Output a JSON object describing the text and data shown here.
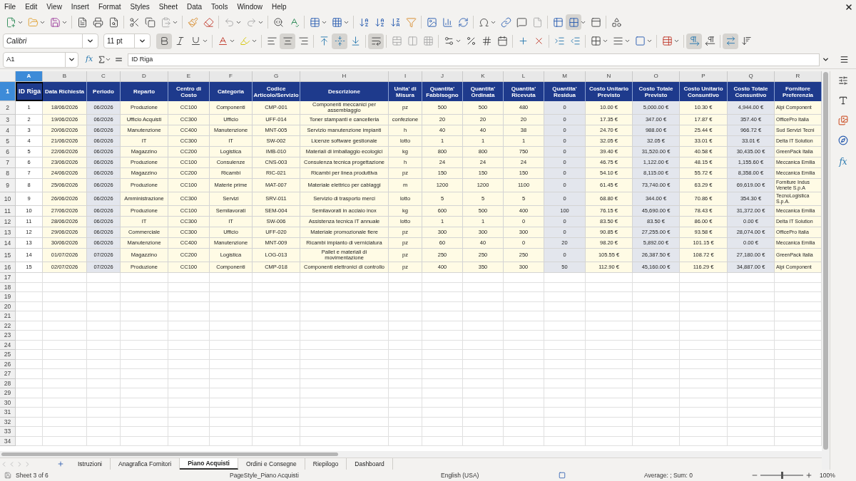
{
  "menu": [
    "File",
    "Edit",
    "View",
    "Insert",
    "Format",
    "Styles",
    "Sheet",
    "Data",
    "Tools",
    "Window",
    "Help"
  ],
  "standard_toolbar": {
    "freeze_rows_columns_on": true
  },
  "font_name": "Calibri",
  "font_size": "11 pt",
  "format_toggles": {
    "bold": true,
    "italic": false,
    "underline": false,
    "align_left": false,
    "align_center": true,
    "align_right": false,
    "valign_top": false,
    "valign_center": true,
    "valign_bottom": false,
    "wrap_text": true,
    "left_to_right": true,
    "right_to_left": false,
    "horizontal_text": true,
    "vertical_text": false
  },
  "name_box": "A1",
  "function_wizard_label": "fx",
  "formula": "ID Riga",
  "columns": [
    {
      "label": "A",
      "selected": true
    },
    {
      "label": "B",
      "selected": false
    },
    {
      "label": "C",
      "selected": false
    },
    {
      "label": "D",
      "selected": false
    },
    {
      "label": "E",
      "selected": false
    },
    {
      "label": "F",
      "selected": false
    },
    {
      "label": "G",
      "selected": false
    },
    {
      "label": "H",
      "selected": false
    },
    {
      "label": "I",
      "selected": false
    },
    {
      "label": "J",
      "selected": false
    },
    {
      "label": "K",
      "selected": false
    },
    {
      "label": "L",
      "selected": false
    },
    {
      "label": "M",
      "selected": false
    },
    {
      "label": "N",
      "selected": false
    },
    {
      "label": "O",
      "selected": false
    },
    {
      "label": "P",
      "selected": false
    },
    {
      "label": "Q",
      "selected": false
    },
    {
      "label": "R",
      "selected": false
    }
  ],
  "header_row": {
    "number": "1",
    "selected": true,
    "cells": [
      "ID Riga",
      "Data Richiesta",
      "Periodo",
      "Reparto",
      "Centro di Costo",
      "Categoria",
      "Codice Articolo/Servizio",
      "Descrizione",
      "Unita' di Misura",
      "Quantita' Fabbisogno",
      "Quantita' Ordinata",
      "Quantita' Ricevuta",
      "Quantita' Residua",
      "Costo Unitario Previsto",
      "Costo Totale Previsto",
      "Costo Unitario Consuntivo",
      "Costo Totale Consuntivo",
      "Fornitore Preferenzia"
    ]
  },
  "rows": [
    {
      "number": "2",
      "cells": [
        "1",
        "18/06/2026",
        "06/2026",
        "Produzione",
        "CC100",
        "Componenti",
        "CMP-001",
        "Componenti meccanici per assemblaggio",
        "pz",
        "500",
        "500",
        "480",
        "0",
        "10.00 €",
        "5,000.00 €",
        "10.30 €",
        "4,944.00 €",
        "Alpi Component"
      ]
    },
    {
      "number": "3",
      "cells": [
        "2",
        "19/06/2026",
        "06/2026",
        "Ufficio Acquisti",
        "CC300",
        "Ufficio",
        "UFF-014",
        "Toner stampanti e cancelleria",
        "confezione",
        "20",
        "20",
        "20",
        "0",
        "17.35 €",
        "347.00 €",
        "17.87 €",
        "357.40 €",
        "OfficePro Italia"
      ]
    },
    {
      "number": "4",
      "cells": [
        "3",
        "20/06/2026",
        "06/2026",
        "Manutenzione",
        "CC400",
        "Manutenzione",
        "MNT-005",
        "Servizio manutenzione impianti",
        "h",
        "40",
        "40",
        "38",
        "0",
        "24.70 €",
        "988.00 €",
        "25.44 €",
        "966.72 €",
        "Sud Servizi Tecni"
      ]
    },
    {
      "number": "5",
      "cells": [
        "4",
        "21/06/2026",
        "06/2026",
        "IT",
        "CC300",
        "IT",
        "SW-002",
        "Licenze software gestionale",
        "lotto",
        "1",
        "1",
        "1",
        "0",
        "32.05 €",
        "32.05 €",
        "33.01 €",
        "33.01 €",
        "Delta IT Solution"
      ]
    },
    {
      "number": "6",
      "cells": [
        "5",
        "22/06/2026",
        "06/2026",
        "Magazzino",
        "CC200",
        "Logistica",
        "IMB-010",
        "Materiali di imballaggio ecologici",
        "kg",
        "800",
        "800",
        "750",
        "0",
        "39.40 €",
        "31,520.00 €",
        "40.58 €",
        "30,435.00 €",
        "GreenPack Italia"
      ]
    },
    {
      "number": "7",
      "cells": [
        "6",
        "23/06/2026",
        "06/2026",
        "Produzione",
        "CC100",
        "Consulenze",
        "CNS-003",
        "Consulenza tecnica progettazione",
        "h",
        "24",
        "24",
        "24",
        "0",
        "46.75 €",
        "1,122.00 €",
        "48.15 €",
        "1,155.60 €",
        "Meccanica Emilia"
      ]
    },
    {
      "number": "8",
      "cells": [
        "7",
        "24/06/2026",
        "06/2026",
        "Magazzino",
        "CC200",
        "Ricambi",
        "RIC-021",
        "Ricambi per linea produttiva",
        "pz",
        "150",
        "150",
        "150",
        "0",
        "54.10 €",
        "8,115.00 €",
        "55.72 €",
        "8,358.00 €",
        "Meccanica Emilia"
      ]
    },
    {
      "number": "9",
      "cells": [
        "8",
        "25/06/2026",
        "06/2026",
        "Produzione",
        "CC100",
        "Materie prime",
        "MAT-007",
        "Materiale elettrico per cablaggi",
        "m",
        "1200",
        "1200",
        "1100",
        "0",
        "61.45 €",
        "73,740.00 €",
        "63.29 €",
        "69,619.00 €",
        "Forniture Indus Venete S.p.A"
      ]
    },
    {
      "number": "10",
      "cells": [
        "9",
        "26/06/2026",
        "06/2026",
        "Amministrazione",
        "CC300",
        "Servizi",
        "SRV-011",
        "Servizio di trasporto merci",
        "lotto",
        "5",
        "5",
        "5",
        "0",
        "68.80 €",
        "344.00 €",
        "70.86 €",
        "354.30 €",
        "TecnoLogistica S.p.A."
      ]
    },
    {
      "number": "11",
      "cells": [
        "10",
        "27/06/2026",
        "06/2026",
        "Produzione",
        "CC100",
        "Semilavorati",
        "SEM-004",
        "Semilavorati in acciaio inox",
        "kg",
        "600",
        "500",
        "400",
        "100",
        "76.15 €",
        "45,690.00 €",
        "78.43 €",
        "31,372.00 €",
        "Meccanica Emilia"
      ]
    },
    {
      "number": "12",
      "cells": [
        "11",
        "28/06/2026",
        "06/2026",
        "IT",
        "CC300",
        "IT",
        "SW-006",
        "Assistenza tecnica IT annuale",
        "lotto",
        "1",
        "1",
        "0",
        "0",
        "83.50 €",
        "83.50 €",
        "86.00 €",
        "0.00 €",
        "Delta IT Solution"
      ]
    },
    {
      "number": "13",
      "cells": [
        "12",
        "29/06/2026",
        "06/2026",
        "Commerciale",
        "CC300",
        "Ufficio",
        "UFF-020",
        "Materiale promozionale fiere",
        "pz",
        "300",
        "300",
        "300",
        "0",
        "90.85 €",
        "27,255.00 €",
        "93.58 €",
        "28,074.00 €",
        "OfficePro Italia"
      ]
    },
    {
      "number": "14",
      "cells": [
        "13",
        "30/06/2026",
        "06/2026",
        "Manutenzione",
        "CC400",
        "Manutenzione",
        "MNT-009",
        "Ricambi impianto di verniciatura",
        "pz",
        "60",
        "40",
        "0",
        "20",
        "98.20 €",
        "5,892.00 €",
        "101.15 €",
        "0.00 €",
        "Meccanica Emilia"
      ]
    },
    {
      "number": "15",
      "cells": [
        "14",
        "01/07/2026",
        "07/2026",
        "Magazzino",
        "CC200",
        "Logistica",
        "LOG-013",
        "Pallet e materiali di movimentazione",
        "pz",
        "250",
        "250",
        "250",
        "0",
        "105.55 €",
        "26,387.50 €",
        "108.72 €",
        "27,180.00 €",
        "GreenPack Italia"
      ]
    },
    {
      "number": "16",
      "cells": [
        "15",
        "02/07/2026",
        "07/2026",
        "Produzione",
        "CC100",
        "Componenti",
        "CMP-018",
        "Componenti elettronici di controllo",
        "pz",
        "400",
        "350",
        "300",
        "50",
        "112.90 €",
        "45,160.00 €",
        "116.29 €",
        "34,887.00 €",
        "Alpi Component"
      ]
    }
  ],
  "empty_rows": [
    "17",
    "18",
    "19",
    "20",
    "21",
    "22",
    "23",
    "24",
    "25",
    "26",
    "27",
    "28",
    "29",
    "30",
    "31",
    "32",
    "33",
    "34"
  ],
  "sheet_tabs": [
    {
      "label": "Istruzioni",
      "selected": false
    },
    {
      "label": "Anagrafica Fornitori",
      "selected": false
    },
    {
      "label": "Piano Acquisti",
      "selected": true
    },
    {
      "label": "Ordini e Consegne",
      "selected": false
    },
    {
      "label": "Riepilogo",
      "selected": false
    },
    {
      "label": "Dashboard",
      "selected": false
    }
  ],
  "sidebar_functions_label": "fx",
  "status_bar": {
    "sheet": "Sheet 3 of 6",
    "page_style": "PageStyle_Piano Acquisti",
    "language": "English (USA)",
    "summary": "Average: ; Sum: 0",
    "zoom": "100%",
    "zoom_slider": {
      "level": 0.5
    }
  }
}
